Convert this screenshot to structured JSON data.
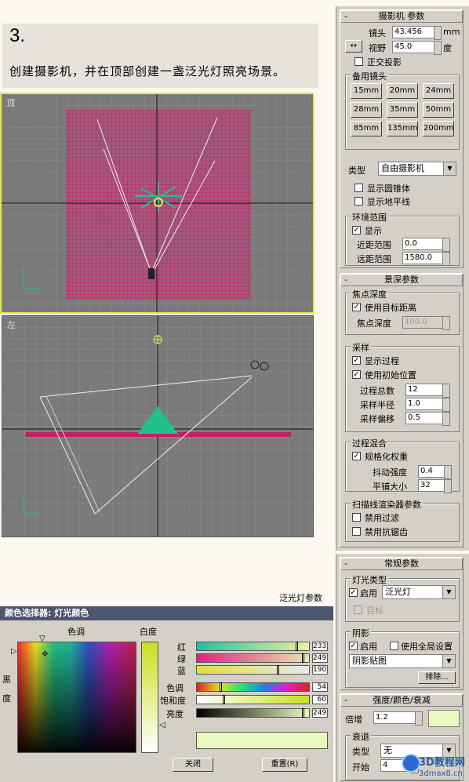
{
  "tutorial": {
    "step": "3.",
    "description": "创建摄影机，并在顶部创建一盏泛光灯照亮场景。"
  },
  "viewports": {
    "top_label": "顶",
    "left_label": "左",
    "caption": "泛光灯参数"
  },
  "camera_params": {
    "title": "摄影机 参数",
    "lens_label": "镜头",
    "lens_value": "43.456",
    "lens_unit": "mm",
    "fov_label": "视野",
    "fov_value": "45.0",
    "fov_unit": "度",
    "ortho_label": "正交投影",
    "stock_lenses_label": "备用镜头",
    "stock_lenses": [
      "15mm",
      "20mm",
      "24mm",
      "28mm",
      "35mm",
      "50mm",
      "85mm",
      "135mm",
      "200mm"
    ],
    "type_label": "类型",
    "type_value": "自由摄影机",
    "show_cone": "显示圆锥体",
    "show_horizon": "显示地平线",
    "env_range_label": "环境范围",
    "show_label": "显示",
    "near_label": "近距范围",
    "near_value": "0.0",
    "far_label": "远距范围",
    "far_value": "1580.0"
  },
  "dof_params": {
    "title": "景深参数",
    "focal_depth_label": "焦点深度",
    "use_target_label": "使用目标距离",
    "focal_depth_field_label": "焦点深度",
    "focal_depth_value": "100.0",
    "sampling_label": "采样",
    "display_passes": "显示过程",
    "use_original": "使用初始位置",
    "total_passes_label": "过程总数",
    "total_passes_value": "12",
    "sample_radius_label": "采样半径",
    "sample_radius_value": "1.0",
    "sample_bias_label": "采样偏移",
    "sample_bias_value": "0.5",
    "pass_blend_label": "过程混合",
    "normalize_label": "规格化权重",
    "dither_label": "抖动强度",
    "dither_value": "0.4",
    "tile_label": "平铺大小",
    "tile_value": "32",
    "scanline_label": "扫描线渲染器参数",
    "disable_filter": "禁用过滤",
    "disable_aa": "禁用抗锯齿"
  },
  "general_params": {
    "title": "常规参数",
    "light_type_label": "灯光类型",
    "on_label": "启用",
    "light_type_value": "泛光灯",
    "target_label": "目标",
    "shadows_label": "阴影",
    "shadow_on_label": "启用",
    "global_label": "使用全局设置",
    "shadow_type": "阴影贴图",
    "exclude_btn": "排除..."
  },
  "intensity_params": {
    "title": "强度/颜色/衰减",
    "multiplier_label": "倍增",
    "multiplier_value": "1.2",
    "decay_label": "衰退",
    "decay_type_label": "类型",
    "decay_type_value": "无",
    "start_label": "开始",
    "start_value": "4"
  },
  "color_picker": {
    "title": "颜色选择器: 灯光颜色",
    "hue_label": "色调",
    "whiteness_label": "白度",
    "blackness_label": "黑度",
    "rows": [
      {
        "label": "红",
        "value": "233",
        "frac": 0.91
      },
      {
        "label": "绿",
        "value": "249",
        "frac": 0.97
      },
      {
        "label": "蓝",
        "value": "190",
        "frac": 0.74
      },
      {
        "label": "色调",
        "value": "54",
        "frac": 0.21
      },
      {
        "label": "饱和度",
        "value": "60",
        "frac": 0.24
      },
      {
        "label": "亮度",
        "value": "249",
        "frac": 0.97
      }
    ],
    "close_btn": "关闭",
    "reset_btn": "重置(R)",
    "swatch_color": "#e9f9be"
  },
  "watermark": {
    "text": "3D教程网",
    "url": "3dmax8.cn"
  },
  "colors": {
    "grid": "#c41e6a",
    "light": "#1fc08a",
    "camera_line": "#e8e8e8"
  }
}
